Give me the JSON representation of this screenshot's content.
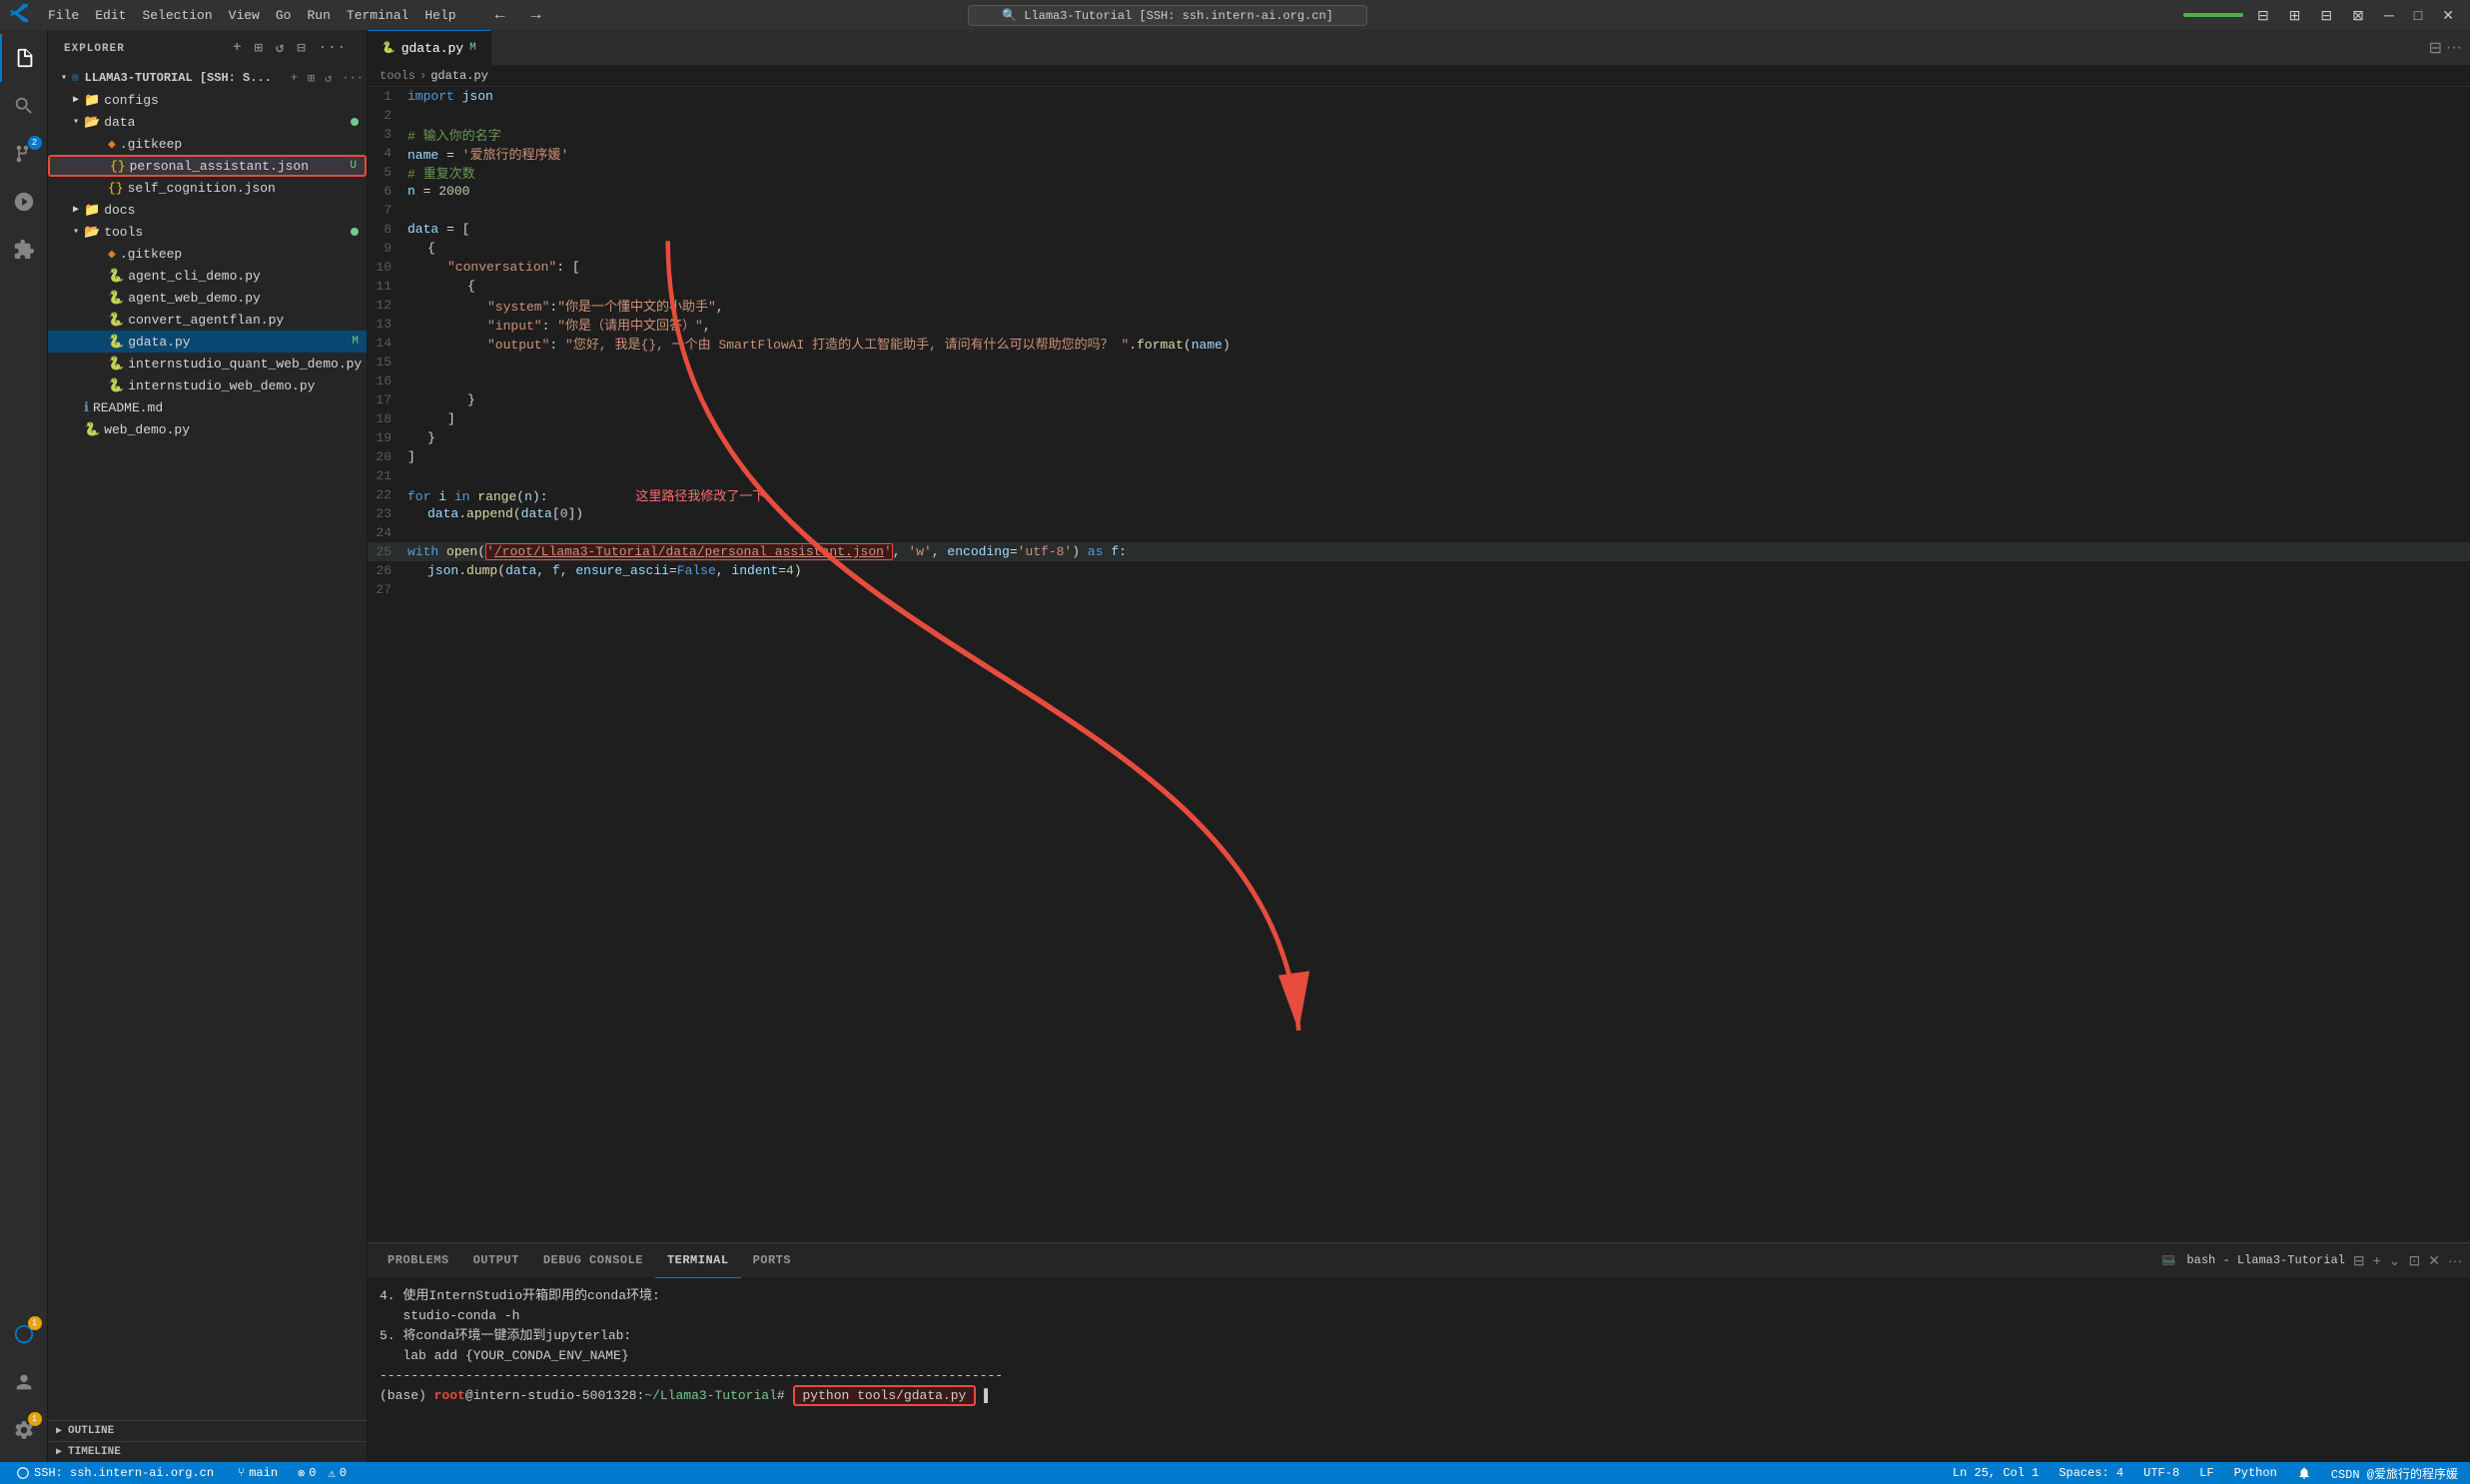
{
  "titlebar": {
    "logo": "VS",
    "menu_items": [
      "File",
      "Edit",
      "Selection",
      "View",
      "Go",
      "Run",
      "Terminal",
      "Help"
    ],
    "nav_back": "←",
    "nav_forward": "→",
    "search_text": "🔍 Llama3-Tutorial [SSH: ssh.intern-ai.org.cn]",
    "progress_label": "",
    "win_min": "─",
    "win_max": "□",
    "win_restore": "⧉",
    "win_close": "✕"
  },
  "activity_bar": {
    "icons": [
      {
        "name": "files-icon",
        "symbol": "⎘",
        "badge": null,
        "active": true
      },
      {
        "name": "search-icon",
        "symbol": "🔍",
        "badge": null
      },
      {
        "name": "source-control-icon",
        "symbol": "⑂",
        "badge": "2"
      },
      {
        "name": "run-debug-icon",
        "symbol": "▷",
        "badge": null
      },
      {
        "name": "extensions-icon",
        "symbol": "⬛",
        "badge": null
      }
    ],
    "bottom_icons": [
      {
        "name": "remote-icon",
        "symbol": "⊞",
        "badge": "1"
      },
      {
        "name": "account-icon",
        "symbol": "👤",
        "badge": null
      },
      {
        "name": "settings-icon",
        "symbol": "⚙",
        "badge": "1"
      }
    ]
  },
  "sidebar": {
    "title": "EXPLORER",
    "root_label": "LLAMA3-TUTORIAL [SSH: S...",
    "tree": [
      {
        "level": 0,
        "type": "folder",
        "name": "configs",
        "collapsed": true
      },
      {
        "level": 0,
        "type": "folder",
        "name": "data",
        "collapsed": false,
        "dot": true
      },
      {
        "level": 1,
        "type": "file",
        "name": ".gitkeep",
        "icon": "git"
      },
      {
        "level": 1,
        "type": "file",
        "name": "personal_assistant.json",
        "icon": "json",
        "highlighted": true,
        "badge": "U"
      },
      {
        "level": 1,
        "type": "file",
        "name": "self_cognition.json",
        "icon": "json"
      },
      {
        "level": 0,
        "type": "folder",
        "name": "docs",
        "collapsed": true
      },
      {
        "level": 0,
        "type": "folder",
        "name": "tools",
        "collapsed": false,
        "dot": true
      },
      {
        "level": 1,
        "type": "file",
        "name": ".gitkeep",
        "icon": "git"
      },
      {
        "level": 1,
        "type": "file",
        "name": "agent_cli_demo.py",
        "icon": "py"
      },
      {
        "level": 1,
        "type": "file",
        "name": "agent_web_demo.py",
        "icon": "py"
      },
      {
        "level": 1,
        "type": "file",
        "name": "convert_agentflan.py",
        "icon": "py"
      },
      {
        "level": 1,
        "type": "file",
        "name": "gdata.py",
        "icon": "py",
        "active": true,
        "badge": "M"
      },
      {
        "level": 1,
        "type": "file",
        "name": "internstudio_quant_web_demo.py",
        "icon": "py"
      },
      {
        "level": 1,
        "type": "file",
        "name": "internstudio_web_demo.py",
        "icon": "py"
      },
      {
        "level": 0,
        "type": "file",
        "name": "README.md",
        "icon": "md"
      },
      {
        "level": 0,
        "type": "file",
        "name": "web_demo.py",
        "icon": "py"
      }
    ],
    "outline_label": "OUTLINE",
    "timeline_label": "TIMELINE"
  },
  "editor": {
    "tab_name": "gdata.py",
    "tab_badge": "M",
    "breadcrumb": [
      "tools",
      "gdata.py"
    ],
    "lines": [
      {
        "num": 1,
        "code": "import json"
      },
      {
        "num": 2,
        "code": ""
      },
      {
        "num": 3,
        "code": "# 输入你的名字"
      },
      {
        "num": 4,
        "code": "name = '爱旅行的程序媛'"
      },
      {
        "num": 5,
        "code": "# 重复次数"
      },
      {
        "num": 6,
        "code": "n = 2000"
      },
      {
        "num": 7,
        "code": ""
      },
      {
        "num": 8,
        "code": "data = ["
      },
      {
        "num": 9,
        "code": "    {"
      },
      {
        "num": 10,
        "code": "        \"conversation\": ["
      },
      {
        "num": 11,
        "code": "            {"
      },
      {
        "num": 12,
        "code": "                \"system\":\"你是一个懂中文的小助手\","
      },
      {
        "num": 13,
        "code": "                \"input\": \"你是（请用中文回答）\","
      },
      {
        "num": 14,
        "code": "                \"output\": \"您好, 我是{}, 一个由 SmartFlowAI 打造的人工智能助手, 请问有什么可以帮助您的吗？\".format(name)"
      },
      {
        "num": 15,
        "code": ""
      },
      {
        "num": 16,
        "code": ""
      },
      {
        "num": 17,
        "code": "            }"
      },
      {
        "num": 18,
        "code": "        ]"
      },
      {
        "num": 19,
        "code": "    }"
      },
      {
        "num": 20,
        "code": "]"
      },
      {
        "num": 21,
        "code": ""
      },
      {
        "num": 22,
        "code": "for i in range(n):"
      },
      {
        "num": 23,
        "code": "    data.append(data[0])"
      },
      {
        "num": 24,
        "code": ""
      },
      {
        "num": 25,
        "code": "with open('/root/Llama3-Tutorial/data/personal_assistant.json', 'w', encoding='utf-8') as f:"
      },
      {
        "num": 26,
        "code": "    json.dump(data, f, ensure_ascii=False, indent=4)"
      },
      {
        "num": 27,
        "code": ""
      }
    ],
    "annotation_text": "这里路径我修改了一下"
  },
  "terminal": {
    "tabs": [
      {
        "label": "PROBLEMS",
        "active": false
      },
      {
        "label": "OUTPUT",
        "active": false
      },
      {
        "label": "DEBUG CONSOLE",
        "active": false
      },
      {
        "label": "TERMINAL",
        "active": true
      },
      {
        "label": "PORTS",
        "active": false
      }
    ],
    "session_label": "bash - Llama3-Tutorial",
    "lines": [
      "",
      "4. 使用InternStudio开箱即用的conda环境:",
      "   studio-conda -h",
      "",
      "5. 将conda环境一键添加到jupyterlab:",
      "   lab add {YOUR_CONDA_ENV_NAME}",
      "",
      "--------------------------------------------------------------------------------",
      "",
      "(base) root@intern-studio-5001328:~/Llama3-Tutorial# python tools/gdata.py"
    ]
  },
  "statusbar": {
    "remote": "⊞ SSH: ssh.intern-ai.org.cn",
    "branch": "⑂ main",
    "errors": "⊗ 0",
    "warnings": "⚠ 0",
    "encoding": "UTF-8",
    "eol": "LF",
    "language": "Python",
    "indent": "Spaces: 4",
    "line_col": "Ln 25, Col 1",
    "right_text": "CSDN @爱旅行的程序媛"
  }
}
